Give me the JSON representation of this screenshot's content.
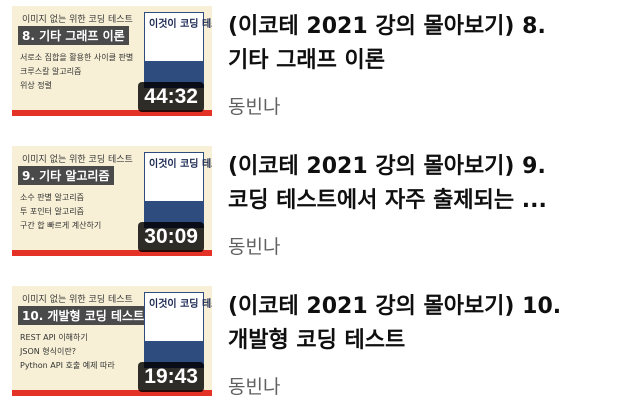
{
  "videos": [
    {
      "title_line1": "(이코테 2021 강의 몰아보기) 8.",
      "title_line2": "기타 그래프 이론",
      "channel": "동빈나",
      "duration": "44:32",
      "thumb": {
        "top": "이미지 없는 위한 코딩 테스트",
        "heading": "8. 기타 그래프 이론",
        "bullets": [
          "서로소 집합을 활용한 사이클 판별",
          "크루스칼 알고리즘",
          "위상 정렬"
        ],
        "book": "이것이 코딩 테스트다"
      }
    },
    {
      "title_line1": "(이코테 2021 강의 몰아보기) 9.",
      "title_line2": "코딩 테스트에서 자주 출제되는 ...",
      "channel": "동빈나",
      "duration": "30:09",
      "thumb": {
        "top": "이미지 없는 위한 코딩 테스트",
        "heading": "9. 기타 알고리즘",
        "bullets": [
          "소수 판별 알고리즘",
          "투 포인터 알고리즘",
          "구간 합 빠르게 계산하기"
        ],
        "book": "이것이 코딩 테스트다"
      }
    },
    {
      "title_line1": "(이코테 2021 강의 몰아보기) 10.",
      "title_line2": "개발형 코딩 테스트",
      "channel": "동빈나",
      "duration": "19:43",
      "thumb": {
        "top": "이미지 없는 위한 코딩 테스트",
        "heading": "10. 개발형 코딩 테스트",
        "bullets": [
          "REST API 이해하기",
          "JSON 형식이란?",
          "Python API 호출 예제 따라"
        ],
        "book": "이것이 코딩 테스트다"
      }
    }
  ]
}
